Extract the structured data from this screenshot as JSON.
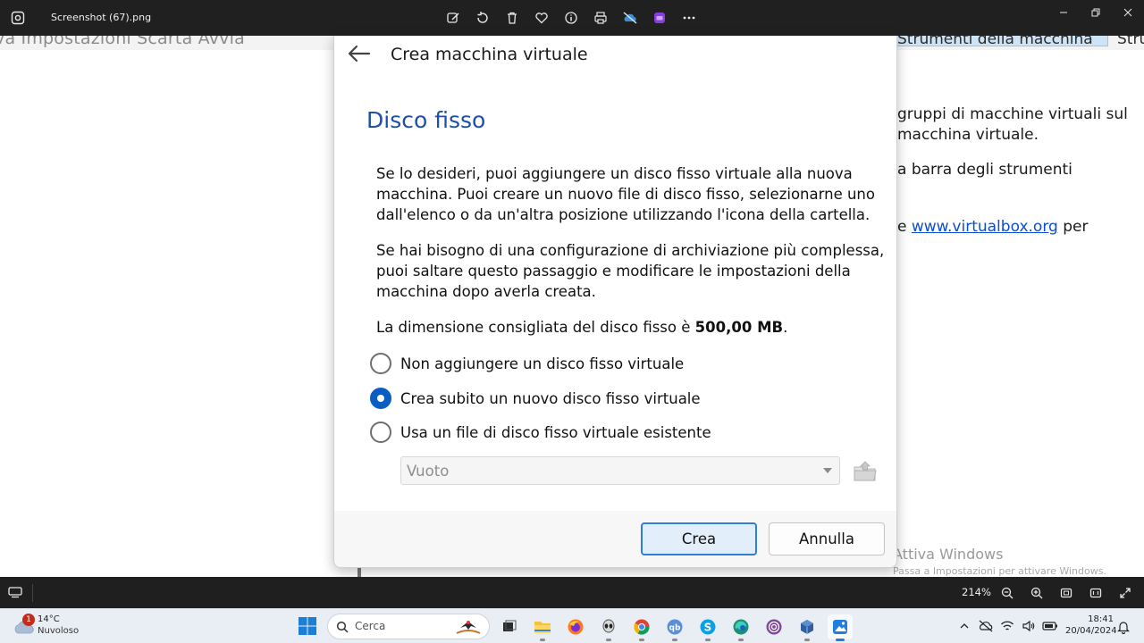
{
  "viewer": {
    "filename": "Screenshot (67).png",
    "zoom": "214%"
  },
  "background_window": {
    "menu_text": "va   Impostazioni   Scarta   Avvia",
    "strumenti_tab": "Strumenti della macchina",
    "strumenti_tab2": "Stru",
    "lines": [
      "gruppi di macchine virtuali sul",
      "macchina virtuale.",
      "a barra degli strumenti"
    ],
    "link_prefix": "e ",
    "link": "www.virtualbox.org",
    "link_suffix": " per",
    "activate_title": "Attiva Windows",
    "activate_sub": "Passa a Impostazioni per attivare Windows."
  },
  "dialog": {
    "title": "Crea macchina virtuale",
    "heading": "Disco fisso",
    "para1": "Se lo desideri, puoi aggiungere un disco fisso virtuale alla nuova macchina. Puoi creare un nuovo file di disco fisso, selezionarne uno dall'elenco o da un'altra posizione utilizzando l'icona della cartella.",
    "para2": "Se hai bisogno di una configurazione di archiviazione più complessa, puoi saltare questo passaggio e modificare le impostazioni della macchina dopo averla creata.",
    "size_prefix": "La dimensione consigliata del disco fisso è ",
    "size_value": "500,00 MB",
    "size_suffix": ".",
    "options": [
      {
        "label": "Non aggiungere un disco fisso virtuale",
        "checked": false
      },
      {
        "label": "Crea subito un nuovo disco fisso virtuale",
        "checked": true
      },
      {
        "label": "Usa un file di disco fisso virtuale esistente",
        "checked": false
      }
    ],
    "combo_value": "Vuoto",
    "create_label": "Crea",
    "cancel_label": "Annulla"
  },
  "taskbar": {
    "weather_badge": "1",
    "temperature": "14°C",
    "condition": "Nuvoloso",
    "search_placeholder": "Cerca",
    "time": "18:41",
    "date": "20/04/2024"
  },
  "colors": {
    "accent": "#0a5dc2",
    "heading": "#1f4fa8",
    "link": "#0b4fcf"
  }
}
